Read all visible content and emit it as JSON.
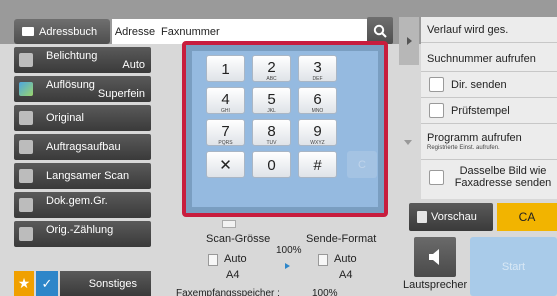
{
  "header": {
    "address_book_label": "Adressbuch",
    "address_label": "Adresse",
    "fax_placeholder": "Faxnummer"
  },
  "left_menu": [
    {
      "title": "Belichtung",
      "value": "Auto"
    },
    {
      "title": "Auflösung",
      "value": "Superfein"
    },
    {
      "title": "Original",
      "value": ""
    },
    {
      "title": "Auftragsaufbau",
      "value": ""
    },
    {
      "title": "Langsamer Scan",
      "value": ""
    },
    {
      "title": "Dok.gem.Gr.",
      "value": ""
    },
    {
      "title": "Orig.-Zählung",
      "value": ""
    }
  ],
  "bottom_left": {
    "other_label": "Sonstiges"
  },
  "keypad": {
    "keys": [
      {
        "num": "1",
        "sub": ""
      },
      {
        "num": "2",
        "sub": "ABC"
      },
      {
        "num": "3",
        "sub": "DEF"
      },
      {
        "num": "4",
        "sub": "GHI"
      },
      {
        "num": "5",
        "sub": "JKL"
      },
      {
        "num": "6",
        "sub": "MNO"
      },
      {
        "num": "7",
        "sub": "PQRS"
      },
      {
        "num": "8",
        "sub": "TUV"
      },
      {
        "num": "9",
        "sub": "WXYZ"
      },
      {
        "num": "✕",
        "sub": ""
      },
      {
        "num": "0",
        "sub": ""
      },
      {
        "num": "#",
        "sub": ""
      }
    ],
    "clear_label": "C"
  },
  "scan": {
    "scan_size_label": "Scan-Grösse",
    "send_format_label": "Sende-Format",
    "ratio": "100%",
    "scan_size_auto": "Auto",
    "send_format_auto": "Auto",
    "scan_paper": "A4",
    "send_paper": "A4",
    "memory_label": "Faxempfangsspeicher :",
    "memory_value": "100%"
  },
  "right_panel": {
    "history": "Verlauf wird ges.",
    "search_number": "Suchnummer aufrufen",
    "direct_send": "Dir. senden",
    "check_stamp": "Prüfstempel",
    "program_call": "Programm aufrufen",
    "program_sub": "Registrierte Einst. aufrufen.",
    "same_image": "Dasselbe Bild wie Faxadresse senden"
  },
  "actions": {
    "preview": "Vorschau",
    "ca": "CA",
    "speaker": "Lautsprecher",
    "start": "Start"
  },
  "colors": {
    "keypad_frame": "#c81d3e",
    "keypad_bg": "#95bae0",
    "ca": "#f2b400",
    "favorite": "#f0a000",
    "check": "#2d86c9"
  }
}
